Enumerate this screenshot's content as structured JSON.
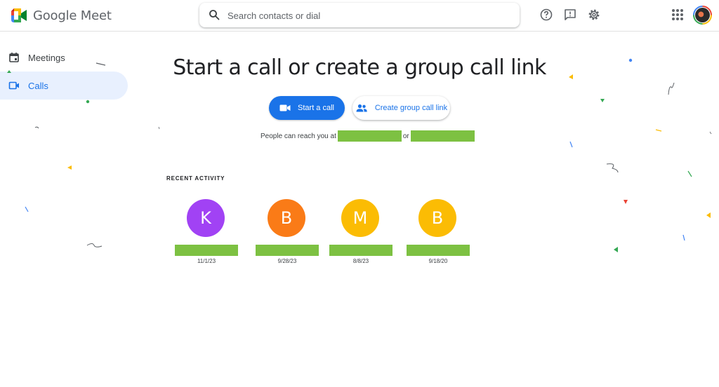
{
  "app": {
    "name": "Google Meet"
  },
  "search": {
    "placeholder": "Search contacts or dial"
  },
  "header_icons": [
    "help-icon",
    "feedback-icon",
    "settings-icon",
    "apps-icon",
    "account-avatar"
  ],
  "sidebar": {
    "items": [
      {
        "label": "Meetings",
        "icon": "calendar-icon",
        "active": false
      },
      {
        "label": "Calls",
        "icon": "video-camera-icon",
        "active": true
      }
    ]
  },
  "main": {
    "headline": "Start a call or create a group call link",
    "start_call_label": "Start a call",
    "create_link_label": "Create group call link",
    "reach_prefix": "People can reach you at",
    "reach_or": "or"
  },
  "recent": {
    "title": "RECENT ACTIVITY",
    "contacts": [
      {
        "initial": "K",
        "color": "#a142f4",
        "date": "11/1/23"
      },
      {
        "initial": "B",
        "color": "#fa7b17",
        "date": "9/28/23"
      },
      {
        "initial": "M",
        "color": "#fbbc04",
        "date": "8/8/23"
      },
      {
        "initial": "B",
        "color": "#fbbc04",
        "date": "9/18/20"
      }
    ]
  },
  "colors": {
    "accent": "#1a73e8",
    "active_nav_bg": "#e8f0fe",
    "redaction": "#7dc142"
  }
}
